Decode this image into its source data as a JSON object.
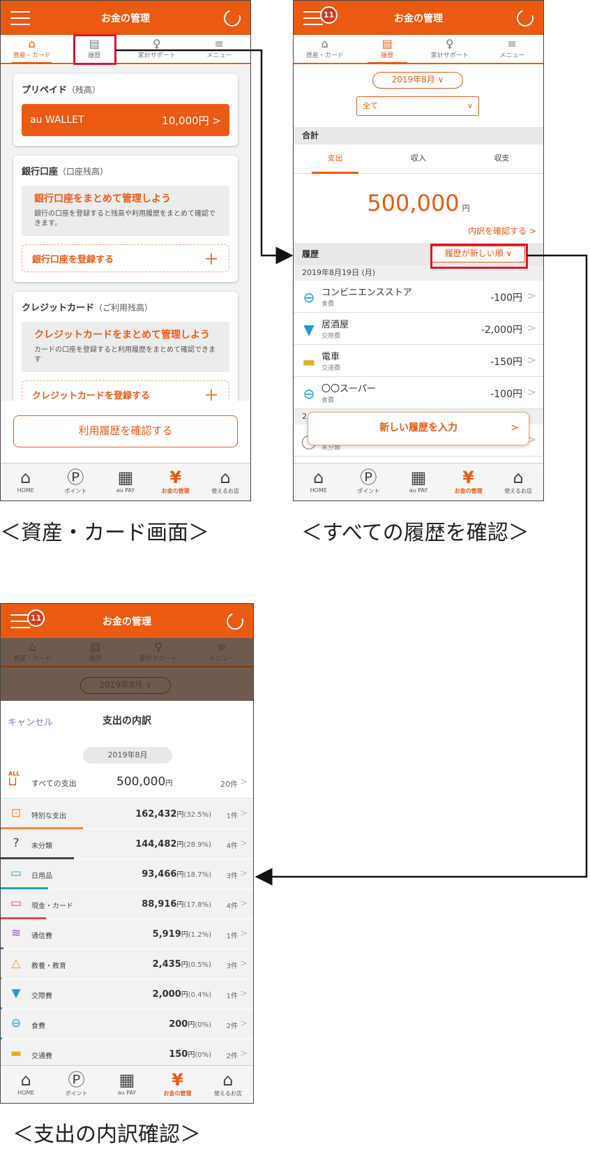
{
  "colors": {
    "brand": "#eb5a13",
    "highlight": "#e0142c"
  },
  "app": {
    "title": "お金の管理",
    "badge": "11"
  },
  "tabs": [
    {
      "label": "資産・カード",
      "icon": "wallet-icon"
    },
    {
      "label": "履歴",
      "icon": "document-icon"
    },
    {
      "label": "家計サポート",
      "icon": "lightbulb-icon"
    },
    {
      "label": "メニュー",
      "icon": "menu-icon"
    }
  ],
  "bottom_nav": [
    {
      "label": "HOME",
      "icon": "home-icon"
    },
    {
      "label": "ポイント",
      "icon": "point-icon"
    },
    {
      "label": "au PAY",
      "icon": "qr-icon"
    },
    {
      "label": "お金の管理",
      "icon": "money-book-icon"
    },
    {
      "label": "使えるお店",
      "icon": "store-icon"
    }
  ],
  "screen1": {
    "prepaid": {
      "title": "プリペイド",
      "sub": "（残高）",
      "wallet_name": "au WALLET",
      "wallet_amount": "10,000円 >"
    },
    "bank": {
      "title": "銀行口座",
      "sub": "（口座残高）",
      "promo_title": "銀行口座をまとめて管理しよう",
      "promo_desc": "銀行の口座を登録すると残高や利用履歴をまとめて確認できます。",
      "register": "銀行口座を登録する"
    },
    "credit": {
      "title": "クレジットカード",
      "sub": "（ご利用残高）",
      "promo_title": "クレジットカードをまとめて管理しよう",
      "promo_desc": "カードの口座を登録すると利用履歴をまとめて確認できます",
      "register": "クレジットカードを登録する"
    },
    "history_button": "利用履歴を確認する",
    "caption": "＜資産・カード画面＞"
  },
  "screen2": {
    "month": "2019年8月  ∨",
    "filter": "全て",
    "total_header": "合計",
    "subtabs": [
      "支出",
      "収入",
      "収支"
    ],
    "amount": "500,000",
    "yen": "円",
    "detail_link": "内訳を確認する >",
    "history_header": "履歴",
    "sort": "履歴が新しい順  ∨",
    "date1": "2019年8月19日 (月)",
    "transactions": [
      {
        "name": "コンビニエンスストア",
        "category": "食費",
        "amount": "-100円",
        "icon": "rice-bowl-icon"
      },
      {
        "name": "居酒屋",
        "category": "交際費",
        "amount": "-2,000円",
        "icon": "cocktail-icon"
      },
      {
        "name": "電車",
        "category": "交通費",
        "amount": "-150円",
        "icon": "train-icon"
      },
      {
        "name": "〇〇スーパー",
        "category": "食費",
        "amount": "-100円",
        "icon": "rice-bowl-icon"
      }
    ],
    "date2": "2",
    "tx5_category": "未分類",
    "new_button": "新しい履歴を入力",
    "caption": "＜すべての履歴を確認＞"
  },
  "screen3": {
    "cancel": "キャンセル",
    "title": "支出の内訳",
    "month": "2019年8月",
    "dim_month": "2019年8月  ∨",
    "all": {
      "badge": "ALL",
      "label": "すべての支出",
      "amount": "500,000",
      "yen": "円",
      "count": "20件"
    },
    "categories": [
      {
        "label": "特別な支出",
        "amount": "162,432",
        "pct": "(32.5%)",
        "count": "1件",
        "color": "#f08a3c",
        "share": 32.5,
        "icon": "special-icon"
      },
      {
        "label": "未分類",
        "amount": "144,482",
        "pct": "(28.9%)",
        "count": "4件",
        "color": "#444444",
        "share": 28.9,
        "icon": "question-icon"
      },
      {
        "label": "日用品",
        "amount": "93,466",
        "pct": "(18.7%)",
        "count": "3件",
        "color": "#1aa3c9",
        "share": 18.7,
        "icon": "tissue-icon"
      },
      {
        "label": "現金・カード",
        "amount": "88,916",
        "pct": "(17.8%)",
        "count": "4件",
        "color": "#e0485a",
        "share": 17.8,
        "icon": "cash-card-icon"
      },
      {
        "label": "通信費",
        "amount": "5,919",
        "pct": "(1.2%)",
        "count": "1件",
        "color": "#9b4fd0",
        "share": 1.2,
        "icon": "wifi-icon"
      },
      {
        "label": "教養・教育",
        "amount": "2,435",
        "pct": "(0.5%)",
        "count": "3件",
        "color": "#f0a030",
        "share": 0.5,
        "icon": "graduation-icon"
      },
      {
        "label": "交際費",
        "amount": "2,000",
        "pct": "(0.4%)",
        "count": "1件",
        "color": "#1a9fd0",
        "share": 0.4,
        "icon": "cocktail-icon"
      },
      {
        "label": "食費",
        "amount": "200",
        "pct": "(0%)",
        "count": "2件",
        "color": "#1a9fd0",
        "share": 0,
        "icon": "rice-bowl-icon"
      },
      {
        "label": "交通費",
        "amount": "150",
        "pct": "(0%)",
        "count": "2件",
        "color": "#e0b020",
        "share": 0,
        "icon": "train-icon"
      }
    ],
    "caption": "＜支出の内訳確認＞"
  }
}
